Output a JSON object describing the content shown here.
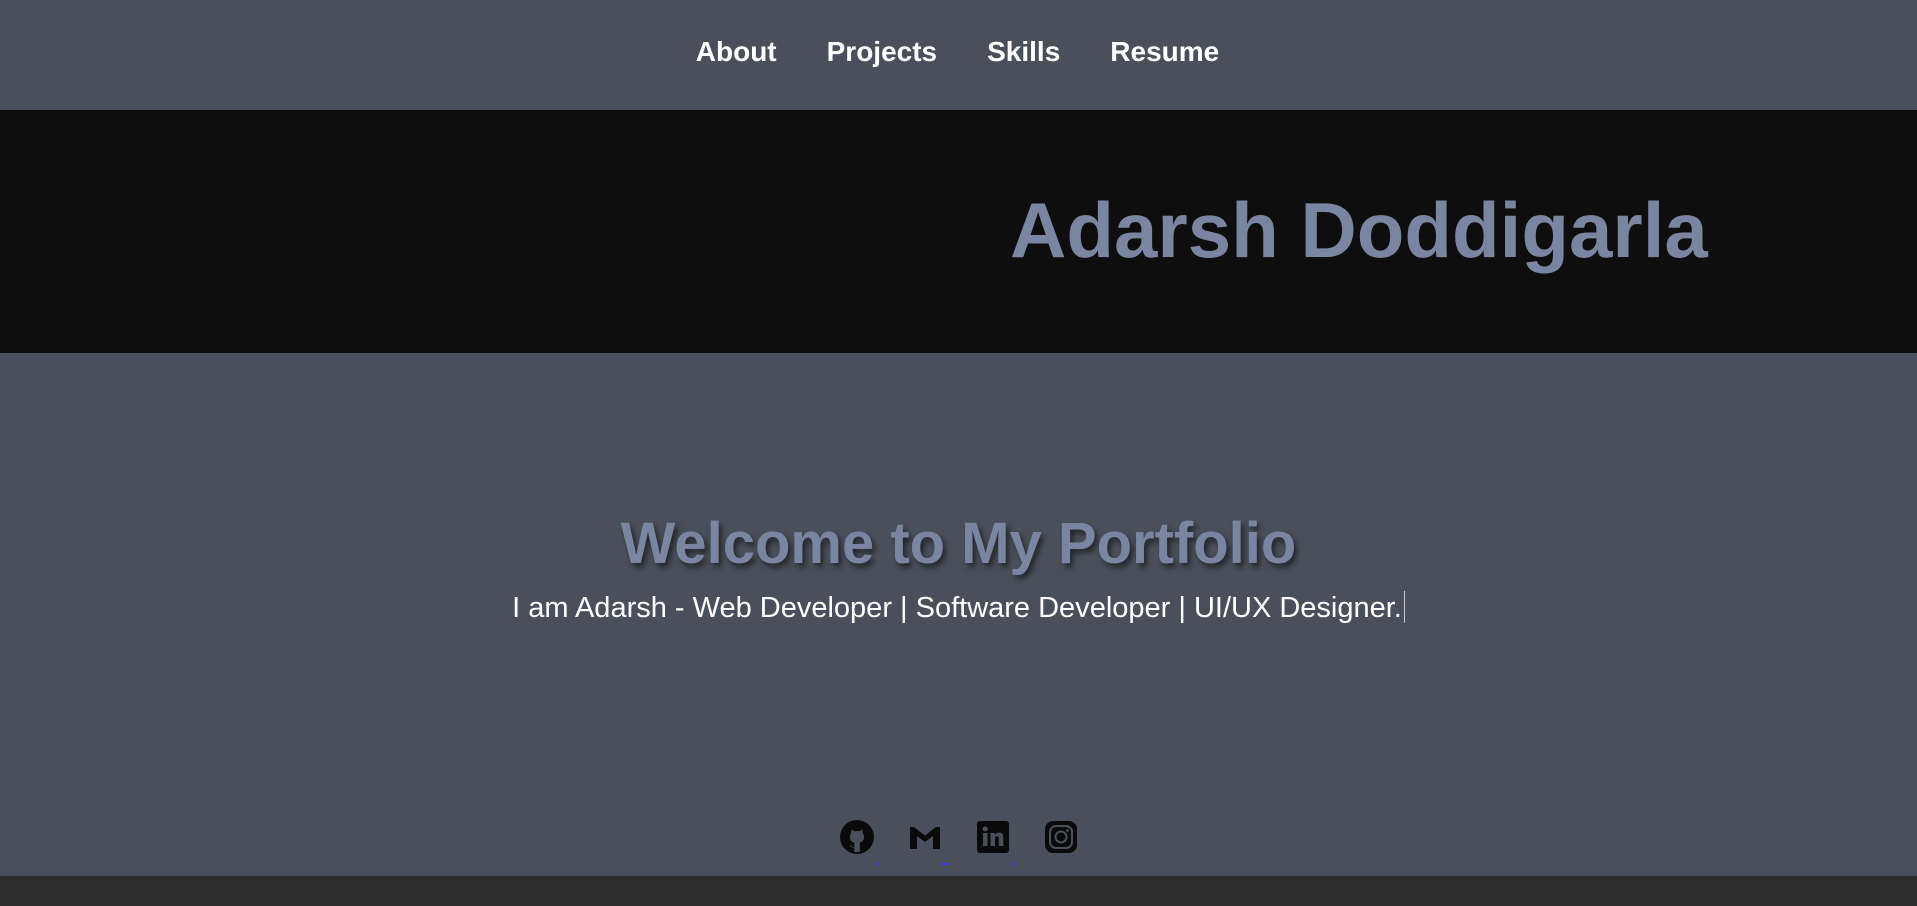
{
  "nav": {
    "items": [
      {
        "label": "About"
      },
      {
        "label": "Projects"
      },
      {
        "label": "Skills"
      },
      {
        "label": "Resume"
      }
    ]
  },
  "banner": {
    "name": "Adarsh Doddigarla"
  },
  "hero": {
    "title": "Welcome to My Portfolio",
    "subtitle": "I am Adarsh - Web Developer | Software Developer | UI/UX Designer."
  },
  "social": {
    "links": [
      {
        "icon": "github-icon"
      },
      {
        "icon": "gmail-icon"
      },
      {
        "icon": "linkedin-icon"
      },
      {
        "icon": "instagram-icon"
      }
    ]
  },
  "colors": {
    "page_bg": "#4a505b",
    "banner_bg": "#0e0e0e",
    "accent_text": "#7a85a1",
    "footer_bg": "#2c2d2c"
  }
}
